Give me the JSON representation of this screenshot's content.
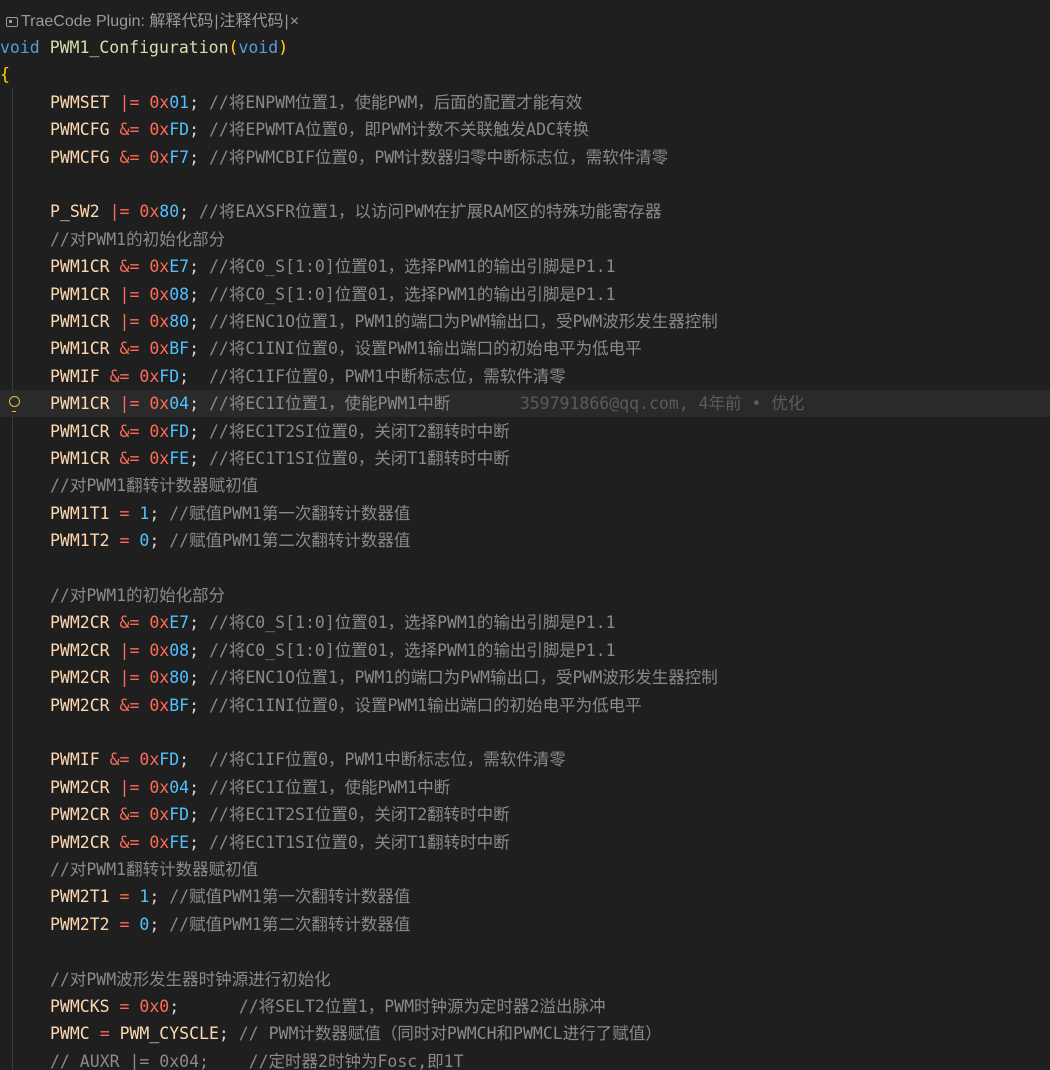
{
  "codelens": {
    "title": "TraeCode Plugin: 解释代码",
    "action_annotate": "注释代码",
    "sep1": "|",
    "sep2": "|",
    "close": "×"
  },
  "blame": "359791866@qq.com, 4年前 • 优化",
  "lines": [
    [
      [
        "kw",
        "void"
      ],
      [
        "pu",
        " "
      ],
      [
        "fn",
        "PWM1_Configuration"
      ],
      [
        "br",
        "("
      ],
      [
        "kw",
        "void"
      ],
      [
        "br",
        ")"
      ]
    ],
    [
      [
        "br",
        "{"
      ]
    ],
    [
      [
        "ind",
        ""
      ],
      [
        "id",
        "PWMSET"
      ],
      [
        "pu",
        " "
      ],
      [
        "op",
        "|="
      ],
      [
        "pu",
        " "
      ],
      [
        "hx",
        "0x"
      ],
      [
        "hd",
        "01"
      ],
      [
        "pu",
        ";"
      ],
      [
        "cm",
        " //将ENPWM位置1，使能PWM，后面的配置才能有效"
      ]
    ],
    [
      [
        "ind",
        ""
      ],
      [
        "id",
        "PWMCFG"
      ],
      [
        "pu",
        " "
      ],
      [
        "op",
        "&="
      ],
      [
        "pu",
        " "
      ],
      [
        "hx",
        "0x"
      ],
      [
        "hd",
        "FD"
      ],
      [
        "pu",
        ";"
      ],
      [
        "cm",
        " //将EPWMTA位置0，即PWM计数不关联触发ADC转换"
      ]
    ],
    [
      [
        "ind",
        ""
      ],
      [
        "id",
        "PWMCFG"
      ],
      [
        "pu",
        " "
      ],
      [
        "op",
        "&="
      ],
      [
        "pu",
        " "
      ],
      [
        "hx",
        "0x"
      ],
      [
        "hd",
        "F7"
      ],
      [
        "pu",
        ";"
      ],
      [
        "cm",
        " //将PWMCBIF位置0，PWM计数器归零中断标志位，需软件清零"
      ]
    ],
    [],
    [
      [
        "ind",
        ""
      ],
      [
        "id",
        "P_SW2"
      ],
      [
        "pu",
        " "
      ],
      [
        "op",
        "|="
      ],
      [
        "pu",
        " "
      ],
      [
        "hx",
        "0x"
      ],
      [
        "hd",
        "80"
      ],
      [
        "pu",
        ";"
      ],
      [
        "cm",
        " //将EAXSFR位置1，以访问PWM在扩展RAM区的特殊功能寄存器"
      ]
    ],
    [
      [
        "ind",
        ""
      ],
      [
        "cm",
        "//对PWM1的初始化部分"
      ]
    ],
    [
      [
        "ind",
        ""
      ],
      [
        "id",
        "PWM1CR"
      ],
      [
        "pu",
        " "
      ],
      [
        "op",
        "&="
      ],
      [
        "pu",
        " "
      ],
      [
        "hx",
        "0x"
      ],
      [
        "hd",
        "E7"
      ],
      [
        "pu",
        ";"
      ],
      [
        "cm",
        " //将C0_S[1:0]位置01，选择PWM1的输出引脚是P1.1"
      ]
    ],
    [
      [
        "ind",
        ""
      ],
      [
        "id",
        "PWM1CR"
      ],
      [
        "pu",
        " "
      ],
      [
        "op",
        "|="
      ],
      [
        "pu",
        " "
      ],
      [
        "hx",
        "0x"
      ],
      [
        "hd",
        "08"
      ],
      [
        "pu",
        ";"
      ],
      [
        "cm",
        " //将C0_S[1:0]位置01，选择PWM1的输出引脚是P1.1"
      ]
    ],
    [
      [
        "ind",
        ""
      ],
      [
        "id",
        "PWM1CR"
      ],
      [
        "pu",
        " "
      ],
      [
        "op",
        "|="
      ],
      [
        "pu",
        " "
      ],
      [
        "hx",
        "0x"
      ],
      [
        "hd",
        "80"
      ],
      [
        "pu",
        ";"
      ],
      [
        "cm",
        " //将ENC1O位置1，PWM1的端口为PWM输出口，受PWM波形发生器控制"
      ]
    ],
    [
      [
        "ind",
        ""
      ],
      [
        "id",
        "PWM1CR"
      ],
      [
        "pu",
        " "
      ],
      [
        "op",
        "&="
      ],
      [
        "pu",
        " "
      ],
      [
        "hx",
        "0x"
      ],
      [
        "hd",
        "BF"
      ],
      [
        "pu",
        ";"
      ],
      [
        "cm",
        " //将C1INI位置0，设置PWM1输出端口的初始电平为低电平"
      ]
    ],
    [
      [
        "ind",
        ""
      ],
      [
        "id",
        "PWMIF"
      ],
      [
        "pu",
        " "
      ],
      [
        "op",
        "&="
      ],
      [
        "pu",
        " "
      ],
      [
        "hx",
        "0x"
      ],
      [
        "hd",
        "FD"
      ],
      [
        "pu",
        ";"
      ],
      [
        "cm",
        "  //将C1IF位置0，PWM1中断标志位，需软件清零"
      ]
    ],
    [
      [
        "ind",
        ""
      ],
      [
        "id",
        "PWM1CR"
      ],
      [
        "pu",
        " "
      ],
      [
        "op",
        "|="
      ],
      [
        "pu",
        " "
      ],
      [
        "hx",
        "0x"
      ],
      [
        "hd",
        "04"
      ],
      [
        "pu",
        ";"
      ],
      [
        "cm",
        " //将EC1I位置1，使能PWM1中断"
      ],
      [
        "pu",
        "       "
      ],
      [
        "blame",
        "@blame"
      ]
    ],
    [
      [
        "ind",
        ""
      ],
      [
        "id",
        "PWM1CR"
      ],
      [
        "pu",
        " "
      ],
      [
        "op",
        "&="
      ],
      [
        "pu",
        " "
      ],
      [
        "hx",
        "0x"
      ],
      [
        "hd",
        "FD"
      ],
      [
        "pu",
        ";"
      ],
      [
        "cm",
        " //将EC1T2SI位置0，关闭T2翻转时中断"
      ]
    ],
    [
      [
        "ind",
        ""
      ],
      [
        "id",
        "PWM1CR"
      ],
      [
        "pu",
        " "
      ],
      [
        "op",
        "&="
      ],
      [
        "pu",
        " "
      ],
      [
        "hx",
        "0x"
      ],
      [
        "hd",
        "FE"
      ],
      [
        "pu",
        ";"
      ],
      [
        "cm",
        " //将EC1T1SI位置0，关闭T1翻转时中断"
      ]
    ],
    [
      [
        "ind",
        ""
      ],
      [
        "cm",
        "//对PWM1翻转计数器赋初值"
      ]
    ],
    [
      [
        "ind",
        ""
      ],
      [
        "id",
        "PWM1T1"
      ],
      [
        "pu",
        " "
      ],
      [
        "op",
        "="
      ],
      [
        "pu",
        " "
      ],
      [
        "nm",
        "1"
      ],
      [
        "pu",
        ";"
      ],
      [
        "cm",
        " //赋值PWM1第一次翻转计数器值"
      ]
    ],
    [
      [
        "ind",
        ""
      ],
      [
        "id",
        "PWM1T2"
      ],
      [
        "pu",
        " "
      ],
      [
        "op",
        "="
      ],
      [
        "pu",
        " "
      ],
      [
        "nm",
        "0"
      ],
      [
        "pu",
        ";"
      ],
      [
        "cm",
        " //赋值PWM1第二次翻转计数器值"
      ]
    ],
    [],
    [
      [
        "ind",
        ""
      ],
      [
        "cm",
        "//对PWM1的初始化部分"
      ]
    ],
    [
      [
        "ind",
        ""
      ],
      [
        "id",
        "PWM2CR"
      ],
      [
        "pu",
        " "
      ],
      [
        "op",
        "&="
      ],
      [
        "pu",
        " "
      ],
      [
        "hx",
        "0x"
      ],
      [
        "hd",
        "E7"
      ],
      [
        "pu",
        ";"
      ],
      [
        "cm",
        " //将C0_S[1:0]位置01，选择PWM1的输出引脚是P1.1"
      ]
    ],
    [
      [
        "ind",
        ""
      ],
      [
        "id",
        "PWM2CR"
      ],
      [
        "pu",
        " "
      ],
      [
        "op",
        "|="
      ],
      [
        "pu",
        " "
      ],
      [
        "hx",
        "0x"
      ],
      [
        "hd",
        "08"
      ],
      [
        "pu",
        ";"
      ],
      [
        "cm",
        " //将C0_S[1:0]位置01，选择PWM1的输出引脚是P1.1"
      ]
    ],
    [
      [
        "ind",
        ""
      ],
      [
        "id",
        "PWM2CR"
      ],
      [
        "pu",
        " "
      ],
      [
        "op",
        "|="
      ],
      [
        "pu",
        " "
      ],
      [
        "hx",
        "0x"
      ],
      [
        "hd",
        "80"
      ],
      [
        "pu",
        ";"
      ],
      [
        "cm",
        " //将ENC1O位置1，PWM1的端口为PWM输出口，受PWM波形发生器控制"
      ]
    ],
    [
      [
        "ind",
        ""
      ],
      [
        "id",
        "PWM2CR"
      ],
      [
        "pu",
        " "
      ],
      [
        "op",
        "&="
      ],
      [
        "pu",
        " "
      ],
      [
        "hx",
        "0x"
      ],
      [
        "hd",
        "BF"
      ],
      [
        "pu",
        ";"
      ],
      [
        "cm",
        " //将C1INI位置0，设置PWM1输出端口的初始电平为低电平"
      ]
    ],
    [],
    [
      [
        "ind",
        ""
      ],
      [
        "id",
        "PWMIF"
      ],
      [
        "pu",
        " "
      ],
      [
        "op",
        "&="
      ],
      [
        "pu",
        " "
      ],
      [
        "hx",
        "0x"
      ],
      [
        "hd",
        "FD"
      ],
      [
        "pu",
        ";"
      ],
      [
        "cm",
        "  //将C1IF位置0，PWM1中断标志位，需软件清零"
      ]
    ],
    [
      [
        "ind",
        ""
      ],
      [
        "id",
        "PWM2CR"
      ],
      [
        "pu",
        " "
      ],
      [
        "op",
        "|="
      ],
      [
        "pu",
        " "
      ],
      [
        "hx",
        "0x"
      ],
      [
        "hd",
        "04"
      ],
      [
        "pu",
        ";"
      ],
      [
        "cm",
        " //将EC1I位置1，使能PWM1中断"
      ]
    ],
    [
      [
        "ind",
        ""
      ],
      [
        "id",
        "PWM2CR"
      ],
      [
        "pu",
        " "
      ],
      [
        "op",
        "&="
      ],
      [
        "pu",
        " "
      ],
      [
        "hx",
        "0x"
      ],
      [
        "hd",
        "FD"
      ],
      [
        "pu",
        ";"
      ],
      [
        "cm",
        " //将EC1T2SI位置0，关闭T2翻转时中断"
      ]
    ],
    [
      [
        "ind",
        ""
      ],
      [
        "id",
        "PWM2CR"
      ],
      [
        "pu",
        " "
      ],
      [
        "op",
        "&="
      ],
      [
        "pu",
        " "
      ],
      [
        "hx",
        "0x"
      ],
      [
        "hd",
        "FE"
      ],
      [
        "pu",
        ";"
      ],
      [
        "cm",
        " //将EC1T1SI位置0，关闭T1翻转时中断"
      ]
    ],
    [
      [
        "ind",
        ""
      ],
      [
        "cm",
        "//对PWM1翻转计数器赋初值"
      ]
    ],
    [
      [
        "ind",
        ""
      ],
      [
        "id",
        "PWM2T1"
      ],
      [
        "pu",
        " "
      ],
      [
        "op",
        "="
      ],
      [
        "pu",
        " "
      ],
      [
        "nm",
        "1"
      ],
      [
        "pu",
        ";"
      ],
      [
        "cm",
        " //赋值PWM1第一次翻转计数器值"
      ]
    ],
    [
      [
        "ind",
        ""
      ],
      [
        "id",
        "PWM2T2"
      ],
      [
        "pu",
        " "
      ],
      [
        "op",
        "="
      ],
      [
        "pu",
        " "
      ],
      [
        "nm",
        "0"
      ],
      [
        "pu",
        ";"
      ],
      [
        "cm",
        " //赋值PWM1第二次翻转计数器值"
      ]
    ],
    [],
    [
      [
        "ind",
        ""
      ],
      [
        "cm",
        "//对PWM波形发生器时钟源进行初始化"
      ]
    ],
    [
      [
        "ind",
        ""
      ],
      [
        "id",
        "PWMCKS"
      ],
      [
        "pu",
        " "
      ],
      [
        "op",
        "="
      ],
      [
        "pu",
        " "
      ],
      [
        "hx",
        "0x0"
      ],
      [
        "pu",
        ";"
      ],
      [
        "cm",
        "      //将SELT2位置1，PWM时钟源为定时器2溢出脉冲"
      ]
    ],
    [
      [
        "ind",
        ""
      ],
      [
        "id",
        "PWMC"
      ],
      [
        "pu",
        " "
      ],
      [
        "op",
        "="
      ],
      [
        "pu",
        " "
      ],
      [
        "id",
        "PWM_CYSCLE"
      ],
      [
        "pu",
        ";"
      ],
      [
        "cm",
        " // PWM计数器赋值（同时对PWMCH和PWMCL进行了赋值）"
      ]
    ],
    [
      [
        "ind",
        ""
      ],
      [
        "cm",
        "// AUXR |= 0x04;    //定时器2时钟为Fosc,即1T"
      ]
    ]
  ]
}
